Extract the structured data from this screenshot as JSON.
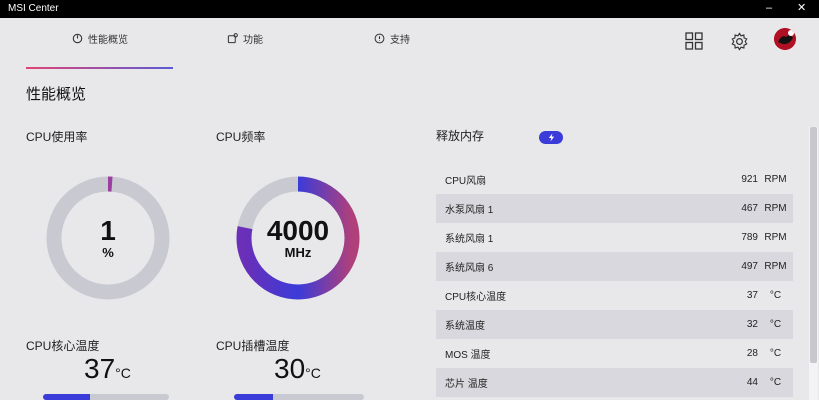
{
  "window": {
    "title": "MSI Center",
    "minimize": "–",
    "close": "✕"
  },
  "tabs": [
    {
      "label": "性能概览",
      "icon": "gauge-icon"
    },
    {
      "label": "功能",
      "icon": "feature-icon"
    },
    {
      "label": "支持",
      "icon": "support-icon"
    }
  ],
  "header_icons": [
    "grid-icon",
    "gear-icon",
    "avatar"
  ],
  "section_title": "性能概览",
  "cpu_usage": {
    "label": "CPU使用率",
    "value": "1",
    "unit": "%",
    "fraction": 0.01
  },
  "cpu_freq": {
    "label": "CPU频率",
    "value": "4000",
    "unit": "MHz",
    "fraction": 0.78
  },
  "cpu_core_temp": {
    "label": "CPU核心温度",
    "value": "37",
    "unit": "°C",
    "fraction": 0.37
  },
  "cpu_socket_temp": {
    "label": "CPU插槽温度",
    "value": "30",
    "unit": "°C",
    "fraction": 0.3
  },
  "memory": {
    "label": "释放内存",
    "button_icon": "lightning-icon"
  },
  "sensors": [
    {
      "name": "CPU风扇",
      "value": "921",
      "unit": "RPM"
    },
    {
      "name": "水泵风扇 1",
      "value": "467",
      "unit": "RPM"
    },
    {
      "name": "系统风扇 1",
      "value": "789",
      "unit": "RPM"
    },
    {
      "name": "系统风扇 6",
      "value": "497",
      "unit": "RPM"
    },
    {
      "name": "CPU核心温度",
      "value": "37",
      "unit": "°C"
    },
    {
      "name": "系统温度",
      "value": "32",
      "unit": "°C"
    },
    {
      "name": "MOS 温度",
      "value": "28",
      "unit": "°C"
    },
    {
      "name": "芯片 温度",
      "value": "44",
      "unit": "°C"
    }
  ],
  "colors": {
    "accent": "#3b3bd9",
    "accent_pink": "#e04575",
    "track": "#c9c9d2",
    "titlebar": "#000000"
  }
}
